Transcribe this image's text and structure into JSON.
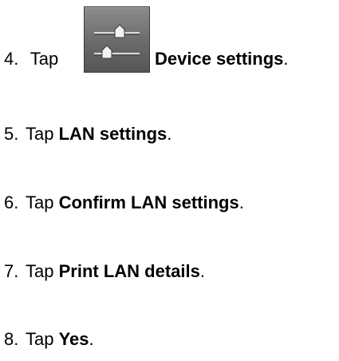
{
  "steps": [
    {
      "num": "4.",
      "prefix": "Tap ",
      "bold": "Device settings",
      "suffix": ".",
      "icon": "device-settings-icon"
    },
    {
      "num": "5.",
      "prefix": "Tap ",
      "bold": "LAN settings",
      "suffix": "."
    },
    {
      "num": "6.",
      "prefix": "Tap ",
      "bold": "Confirm LAN settings",
      "suffix": "."
    },
    {
      "num": "7.",
      "prefix": "Tap ",
      "bold": "Print LAN details",
      "suffix": "."
    },
    {
      "num": "8.",
      "prefix": "Tap ",
      "bold": "Yes",
      "suffix": "."
    }
  ]
}
